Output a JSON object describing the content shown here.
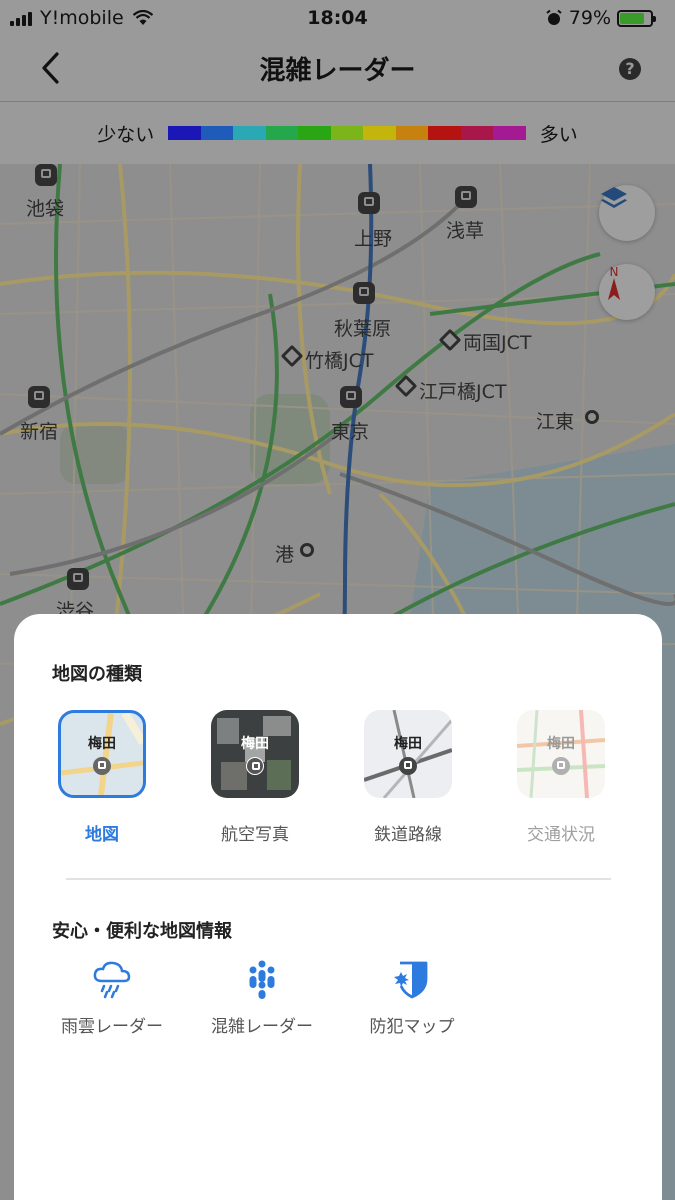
{
  "status_bar": {
    "carrier": "Y!mobile",
    "time": "18:04",
    "battery": "79%"
  },
  "nav": {
    "title": "混雑レーダー",
    "help": "?"
  },
  "legend": {
    "low": "少ない",
    "high": "多い",
    "colors": [
      "#1a17b6",
      "#1f5bb8",
      "#2aa9b5",
      "#25a84c",
      "#2aa513",
      "#7bb51a",
      "#c4b50c",
      "#c7810f",
      "#b5130f",
      "#a8164a",
      "#a41a93"
    ]
  },
  "map": {
    "labels": [
      "池袋",
      "上野",
      "浅草",
      "秋葉原",
      "両国JCT",
      "竹橋JCT",
      "江戸橋JCT",
      "新宿",
      "東京",
      "江東",
      "港",
      "渋谷"
    ],
    "compass": "N"
  },
  "sheet": {
    "map_types_title": "地図の種類",
    "map_types": [
      {
        "label": "地図",
        "thumb_label": "梅田",
        "selected": true
      },
      {
        "label": "航空写真",
        "thumb_label": "梅田",
        "selected": false
      },
      {
        "label": "鉄道路線",
        "thumb_label": "梅田",
        "selected": false
      },
      {
        "label": "交通状況",
        "thumb_label": "梅田",
        "selected": false
      }
    ],
    "info_title": "安心・便利な地図情報",
    "features": [
      {
        "label": "雨雲レーダー",
        "icon": "rain-cloud-icon"
      },
      {
        "label": "混雑レーダー",
        "icon": "crowd-icon"
      },
      {
        "label": "防犯マップ",
        "icon": "shield-icon"
      }
    ],
    "accent": "#2e7be0"
  }
}
